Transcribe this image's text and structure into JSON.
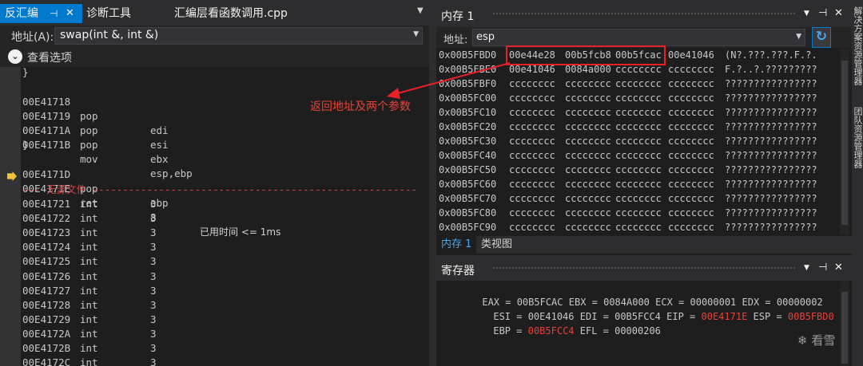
{
  "left_pane": {
    "tabs": [
      {
        "label": "反汇编",
        "pin": "⊣",
        "close": "✕"
      },
      {
        "label": "诊断工具"
      },
      {
        "label": "汇编层看函数调用.cpp"
      }
    ],
    "tab_menu_glyph": "▼",
    "address_label": "地址(A):",
    "address_value": "swap(int &, int &)",
    "dropdown_glyph": "▼",
    "view_options_label": "查看选项",
    "view_options_glyph": "⌄"
  },
  "code": {
    "brace_close_1": "}",
    "brace_close_2": "}",
    "lines_top": [
      {
        "addr": "00E41718",
        "op": "pop",
        "arg": "edi"
      },
      {
        "addr": "00E41719",
        "op": "pop",
        "arg": "esi"
      },
      {
        "addr": "00E4171A",
        "op": "pop",
        "arg": "ebx"
      },
      {
        "addr": "00E4171B",
        "op": "mov",
        "arg": "esp,ebp"
      }
    ],
    "lines_mid": [
      {
        "addr": "00E4171D",
        "op": "pop",
        "arg": "ebp"
      },
      {
        "addr": "00E4171E",
        "op": "ret",
        "arg": "8",
        "annotation": "已用时间 <= 1ms"
      }
    ],
    "no_source": "--- 无源文件 -------------------------------------------------------------------------------",
    "lines_int": [
      {
        "addr": "00E41721",
        "op": "int",
        "arg": "3"
      },
      {
        "addr": "00E41722",
        "op": "int",
        "arg": "3"
      },
      {
        "addr": "00E41723",
        "op": "int",
        "arg": "3"
      },
      {
        "addr": "00E41724",
        "op": "int",
        "arg": "3"
      },
      {
        "addr": "00E41725",
        "op": "int",
        "arg": "3"
      },
      {
        "addr": "00E41726",
        "op": "int",
        "arg": "3"
      },
      {
        "addr": "00E41727",
        "op": "int",
        "arg": "3"
      },
      {
        "addr": "00E41728",
        "op": "int",
        "arg": "3"
      },
      {
        "addr": "00E41729",
        "op": "int",
        "arg": "3"
      },
      {
        "addr": "00E4172A",
        "op": "int",
        "arg": "3"
      },
      {
        "addr": "00E4172B",
        "op": "int",
        "arg": "3"
      },
      {
        "addr": "00E4172C",
        "op": "int",
        "arg": "3"
      }
    ]
  },
  "memory": {
    "title": "内存 1",
    "pin": "⊣",
    "close": "✕",
    "menu": "▼",
    "address_label": "地址:",
    "address_value": "esp",
    "refresh_glyph": "↻",
    "rows": [
      {
        "addr": "0x00B5FBD0",
        "words": [
          "00e44e28",
          "00b5fcb8",
          "00b5fcac",
          "00e41046"
        ],
        "ascii": "(N?.???.???.F.?."
      },
      {
        "addr": "0x00B5FBE0",
        "words": [
          "00e41046",
          "0084a000",
          "cccccccc",
          "cccccccc"
        ],
        "ascii": "F.?..?.?????????"
      },
      {
        "addr": "0x00B5FBF0",
        "words": [
          "cccccccc",
          "cccccccc",
          "cccccccc",
          "cccccccc"
        ],
        "ascii": "????????????????"
      },
      {
        "addr": "0x00B5FC00",
        "words": [
          "cccccccc",
          "cccccccc",
          "cccccccc",
          "cccccccc"
        ],
        "ascii": "????????????????"
      },
      {
        "addr": "0x00B5FC10",
        "words": [
          "cccccccc",
          "cccccccc",
          "cccccccc",
          "cccccccc"
        ],
        "ascii": "????????????????"
      },
      {
        "addr": "0x00B5FC20",
        "words": [
          "cccccccc",
          "cccccccc",
          "cccccccc",
          "cccccccc"
        ],
        "ascii": "????????????????"
      },
      {
        "addr": "0x00B5FC30",
        "words": [
          "cccccccc",
          "cccccccc",
          "cccccccc",
          "cccccccc"
        ],
        "ascii": "????????????????"
      },
      {
        "addr": "0x00B5FC40",
        "words": [
          "cccccccc",
          "cccccccc",
          "cccccccc",
          "cccccccc"
        ],
        "ascii": "????????????????"
      },
      {
        "addr": "0x00B5FC50",
        "words": [
          "cccccccc",
          "cccccccc",
          "cccccccc",
          "cccccccc"
        ],
        "ascii": "????????????????"
      },
      {
        "addr": "0x00B5FC60",
        "words": [
          "cccccccc",
          "cccccccc",
          "cccccccc",
          "cccccccc"
        ],
        "ascii": "????????????????"
      },
      {
        "addr": "0x00B5FC70",
        "words": [
          "cccccccc",
          "cccccccc",
          "cccccccc",
          "cccccccc"
        ],
        "ascii": "????????????????"
      },
      {
        "addr": "0x00B5FC80",
        "words": [
          "cccccccc",
          "cccccccc",
          "cccccccc",
          "cccccccc"
        ],
        "ascii": "????????????????"
      },
      {
        "addr": "0x00B5FC90",
        "words": [
          "cccccccc",
          "cccccccc",
          "cccccccc",
          "cccccccc"
        ],
        "ascii": "????????????????"
      }
    ],
    "tabs": [
      "内存 1",
      "类视图"
    ]
  },
  "annotation_text": "返回地址及两个参数",
  "registers": {
    "title": "寄存器",
    "pin": "⊣",
    "close": "✕",
    "menu": "▼",
    "eax": "EAX = 00B5FCAC",
    "ebx": "EBX = 0084A000",
    "ecx": "ECX = 00000001",
    "edx": "EDX = 00000002",
    "esi": "ESI = 00E41046",
    "edi": "EDI = 00B5FCC4",
    "eip_label": "EIP = ",
    "eip_value": "00E4171E",
    "esp_label": "ESP = ",
    "esp_value": "00B5FBD0",
    "ebp_label": "EBP = ",
    "ebp_value": "00B5FCC4",
    "efl": "EFL = 00000206"
  },
  "watermark": "❄ 看雪",
  "edge_labels": [
    "解决方案资源管理器",
    "团队资源管理器"
  ],
  "colors": {
    "accent": "#007acc",
    "changed_register": "#e8403a",
    "highlight": "#e8202a"
  }
}
